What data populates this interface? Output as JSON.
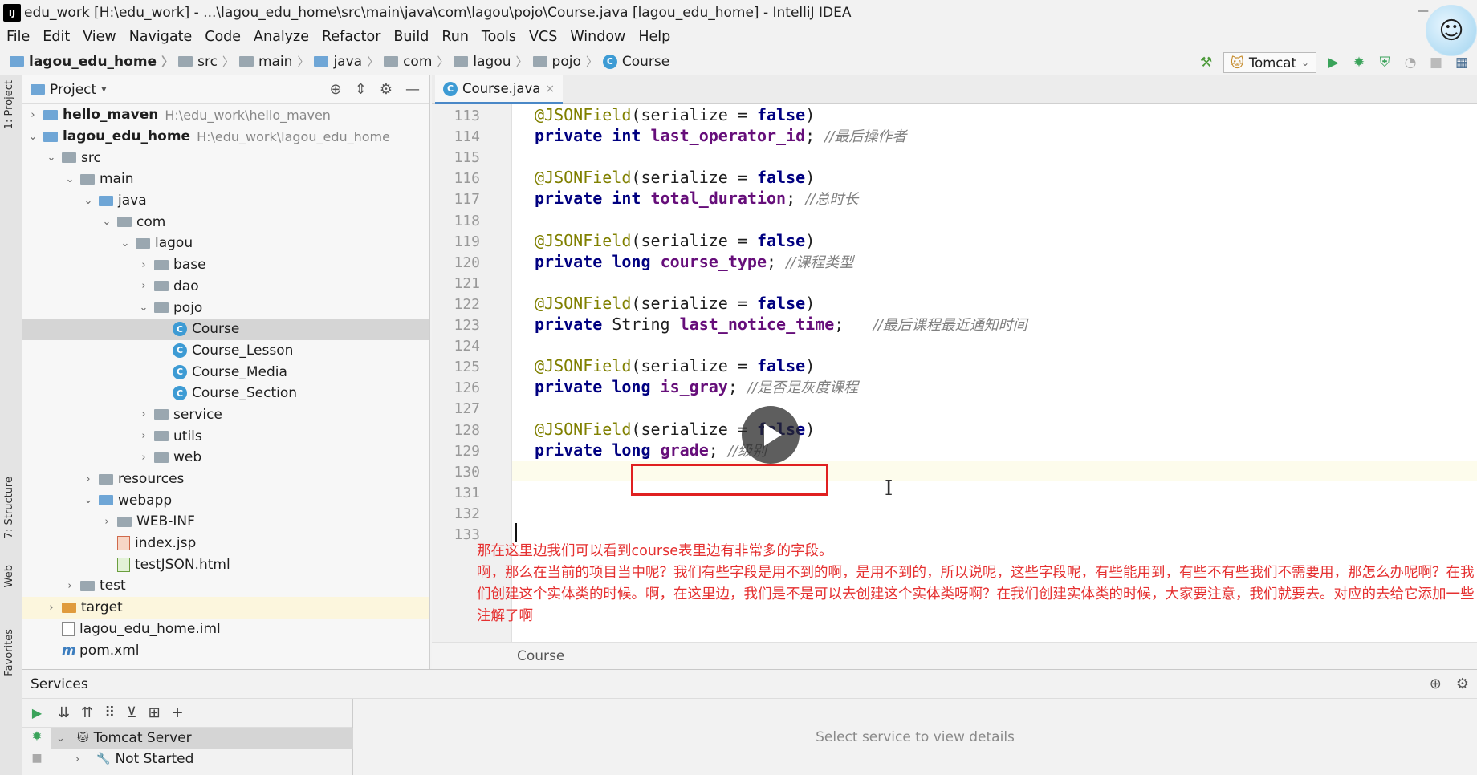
{
  "window": {
    "title": "edu_work [H:\\edu_work] - ...\\lagou_edu_home\\src\\main\\java\\com\\lagou\\pojo\\Course.java [lagou_edu_home] - IntelliJ IDEA",
    "minimize": "—"
  },
  "menu": [
    "File",
    "Edit",
    "View",
    "Navigate",
    "Code",
    "Analyze",
    "Refactor",
    "Build",
    "Run",
    "Tools",
    "VCS",
    "Window",
    "Help"
  ],
  "nav": {
    "crumbs": [
      "lagou_edu_home",
      "src",
      "main",
      "java",
      "com",
      "lagou",
      "pojo",
      "Course"
    ],
    "separator": "〉"
  },
  "toolbar": {
    "run_config": "Tomcat",
    "icons": [
      "hammer-icon",
      "run-icon",
      "debug-icon",
      "coverage-icon",
      "profile-icon",
      "stop-icon",
      "project-structure-icon"
    ]
  },
  "left_strip": {
    "project_tab": "1: Project",
    "structure_tab": "7: Structure",
    "web_tab": "Web",
    "favorites_tab": "Favorites"
  },
  "project": {
    "title": "Project",
    "dropdown": "▾",
    "tree": [
      {
        "label": "hello_maven",
        "path": "H:\\edu_work\\hello_maven",
        "depth": 0,
        "arrow": "›",
        "icon": "module",
        "bold": true
      },
      {
        "label": "lagou_edu_home",
        "path": "H:\\edu_work\\lagou_edu_home",
        "depth": 0,
        "arrow": "⌄",
        "icon": "module",
        "bold": true
      },
      {
        "label": "src",
        "depth": 1,
        "arrow": "⌄",
        "icon": "folder"
      },
      {
        "label": "main",
        "depth": 2,
        "arrow": "⌄",
        "icon": "folder"
      },
      {
        "label": "java",
        "depth": 3,
        "arrow": "⌄",
        "icon": "folder-blue"
      },
      {
        "label": "com",
        "depth": 4,
        "arrow": "⌄",
        "icon": "folder"
      },
      {
        "label": "lagou",
        "depth": 5,
        "arrow": "⌄",
        "icon": "folder"
      },
      {
        "label": "base",
        "depth": 6,
        "arrow": "›",
        "icon": "folder"
      },
      {
        "label": "dao",
        "depth": 6,
        "arrow": "›",
        "icon": "folder"
      },
      {
        "label": "pojo",
        "depth": 6,
        "arrow": "⌄",
        "icon": "folder"
      },
      {
        "label": "Course",
        "depth": 7,
        "arrow": "",
        "icon": "class",
        "selected": true
      },
      {
        "label": "Course_Lesson",
        "depth": 7,
        "arrow": "",
        "icon": "class"
      },
      {
        "label": "Course_Media",
        "depth": 7,
        "arrow": "",
        "icon": "class"
      },
      {
        "label": "Course_Section",
        "depth": 7,
        "arrow": "",
        "icon": "class"
      },
      {
        "label": "service",
        "depth": 6,
        "arrow": "›",
        "icon": "folder"
      },
      {
        "label": "utils",
        "depth": 6,
        "arrow": "›",
        "icon": "folder"
      },
      {
        "label": "web",
        "depth": 6,
        "arrow": "›",
        "icon": "folder"
      },
      {
        "label": "resources",
        "depth": 3,
        "arrow": "›",
        "icon": "folder"
      },
      {
        "label": "webapp",
        "depth": 3,
        "arrow": "⌄",
        "icon": "folder-blue"
      },
      {
        "label": "WEB-INF",
        "depth": 4,
        "arrow": "›",
        "icon": "folder"
      },
      {
        "label": "index.jsp",
        "depth": 4,
        "arrow": "",
        "icon": "jsp"
      },
      {
        "label": "testJSON.html",
        "depth": 4,
        "arrow": "",
        "icon": "html"
      },
      {
        "label": "test",
        "depth": 2,
        "arrow": "›",
        "icon": "folder"
      },
      {
        "label": "target",
        "depth": 1,
        "arrow": "›",
        "icon": "folder-orange",
        "target": true
      },
      {
        "label": "lagou_edu_home.iml",
        "depth": 1,
        "arrow": "",
        "icon": "file"
      },
      {
        "label": "pom.xml",
        "depth": 1,
        "arrow": "",
        "icon": "maven"
      }
    ]
  },
  "editor": {
    "tab": "Course.java",
    "tab_close": "×",
    "current_line": "130",
    "lines": [
      {
        "n": "113",
        "type": "ann",
        "annotation": "@JSONField",
        "open": "(serialize = ",
        "value": "false",
        "close": ")"
      },
      {
        "n": "114",
        "type": "field",
        "mod": "private",
        "ftype": "int",
        "name": "last_operator_id",
        "semi": ";",
        "comment": "//最后操作者"
      },
      {
        "n": "115",
        "type": "blank"
      },
      {
        "n": "116",
        "type": "ann",
        "annotation": "@JSONField",
        "open": "(serialize = ",
        "value": "false",
        "close": ")"
      },
      {
        "n": "117",
        "type": "field",
        "mod": "private",
        "ftype": "int",
        "name": "total_duration",
        "semi": ";",
        "comment": "//总时长"
      },
      {
        "n": "118",
        "type": "blank"
      },
      {
        "n": "119",
        "type": "ann",
        "annotation": "@JSONField",
        "open": "(serialize = ",
        "value": "false",
        "close": ")"
      },
      {
        "n": "120",
        "type": "field",
        "mod": "private",
        "ftype": "long",
        "name": "course_type",
        "semi": ";",
        "comment": "//课程类型"
      },
      {
        "n": "121",
        "type": "blank"
      },
      {
        "n": "122",
        "type": "ann",
        "annotation": "@JSONField",
        "open": "(serialize = ",
        "value": "false",
        "close": ")"
      },
      {
        "n": "123",
        "type": "field",
        "mod": "private",
        "ftype": "String",
        "name": "last_notice_time",
        "semi": ";  ",
        "comment": "//最后课程最近通知时间"
      },
      {
        "n": "124",
        "type": "blank"
      },
      {
        "n": "125",
        "type": "ann",
        "annotation": "@JSONField",
        "open": "(serialize = ",
        "value": "false",
        "close": ")"
      },
      {
        "n": "126",
        "type": "field",
        "mod": "private",
        "ftype": "long",
        "name": "is_gray",
        "semi": ";",
        "comment": "//是否是灰度课程"
      },
      {
        "n": "127",
        "type": "blank"
      },
      {
        "n": "128",
        "type": "ann",
        "annotation": "@JSONField",
        "open": "(serialize = ",
        "value": "false",
        "close": ")"
      },
      {
        "n": "129",
        "type": "field",
        "mod": "private",
        "ftype": "long",
        "name": "grade",
        "semi": ";",
        "comment": "//级别"
      },
      {
        "n": "130",
        "type": "blank"
      },
      {
        "n": "131",
        "type": "blank"
      },
      {
        "n": "132",
        "type": "blank"
      },
      {
        "n": "133",
        "type": "blank"
      }
    ],
    "bottom_breadcrumb": "Course"
  },
  "subtitle": {
    "line1": "那在这里边我们可以看到course表里边有非常多的字段。",
    "line2": "啊，那么在当前的项目当中呢？我们有些字段是用不到的啊，是用不到的，所以说呢，这些字段呢，有些能用到，有些不有些我们不需要用，那怎么办呢啊？在我们创建这个实体类的时候。啊，在这里边，我们是不是可以去创建这个实体类呀啊？在我们创建实体类的时候，大家要注意，我们就要去。对应的去给它添加一些注解了啊"
  },
  "services": {
    "title": "Services",
    "tree": [
      {
        "label": "Tomcat Server",
        "arrow": "⌄",
        "selected": true
      },
      {
        "label": "Not Started",
        "arrow": "›",
        "selected": false
      }
    ],
    "detail_placeholder": "Select service to view details"
  },
  "colors": {
    "annotation": "#808000",
    "keyword": "#000080",
    "field": "#660e7a",
    "comment": "#808080",
    "highlight_box": "#e02020",
    "subtitle": "#e53030"
  }
}
